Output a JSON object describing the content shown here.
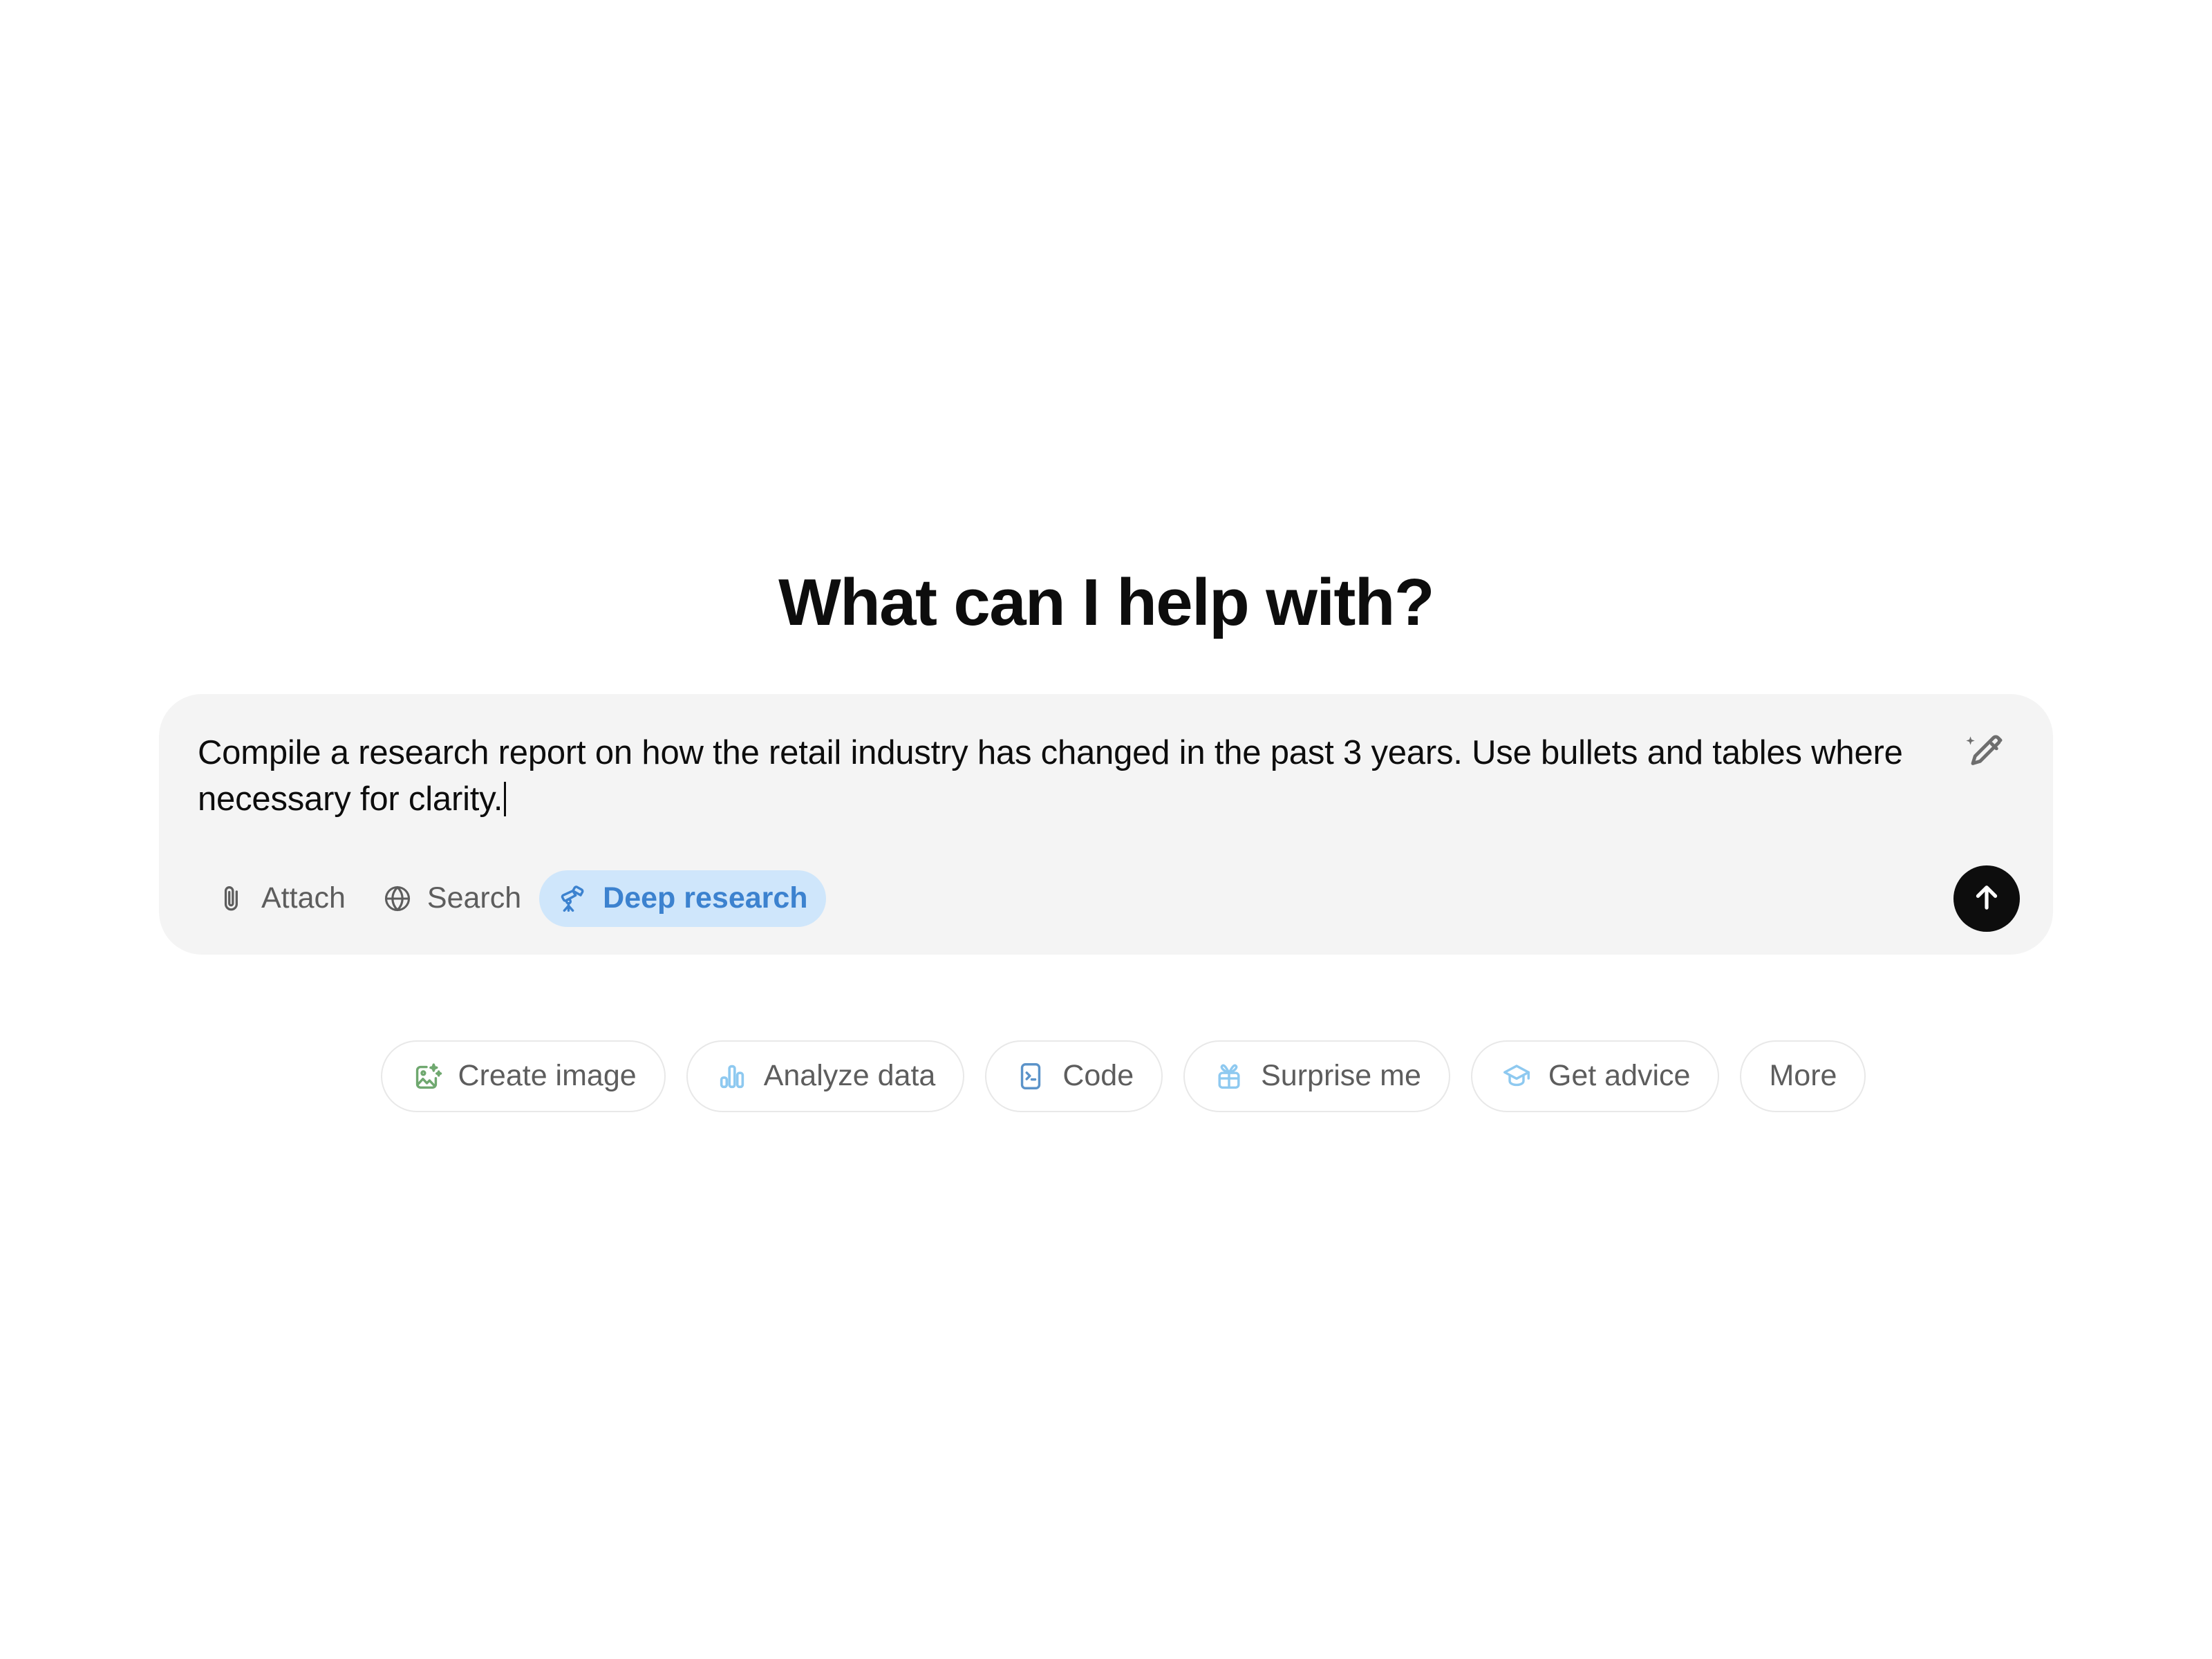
{
  "headline": "What can I help with?",
  "composer": {
    "text": "Compile a research report on how the retail industry has changed in the past 3 years. Use bullets and tables where necessary for clarity.",
    "caret_visible": true,
    "enhance_icon": "magic-pencil-icon",
    "send_icon": "arrow-up-icon",
    "background_color": "#f4f4f4",
    "tools": [
      {
        "label": "Attach",
        "icon": "paperclip-icon",
        "active": false
      },
      {
        "label": "Search",
        "icon": "globe-icon",
        "active": false
      },
      {
        "label": "Deep research",
        "icon": "telescope-icon",
        "active": true
      }
    ],
    "active_pill_bg": "#cfe6fb",
    "active_pill_fg": "#3c82cf"
  },
  "suggestions": [
    {
      "label": "Create image",
      "icon": "image-icon",
      "icon_color": "#6fa86f"
    },
    {
      "label": "Analyze data",
      "icon": "bar-chart-icon",
      "icon_color": "#8ec9f0"
    },
    {
      "label": "Code",
      "icon": "terminal-icon",
      "icon_color": "#5b93c9"
    },
    {
      "label": "Surprise me",
      "icon": "gift-icon",
      "icon_color": "#8ec9f0"
    },
    {
      "label": "Get advice",
      "icon": "graduation-cap-icon",
      "icon_color": "#8ec9f0"
    },
    {
      "label": "More",
      "icon": "",
      "icon_color": ""
    }
  ]
}
